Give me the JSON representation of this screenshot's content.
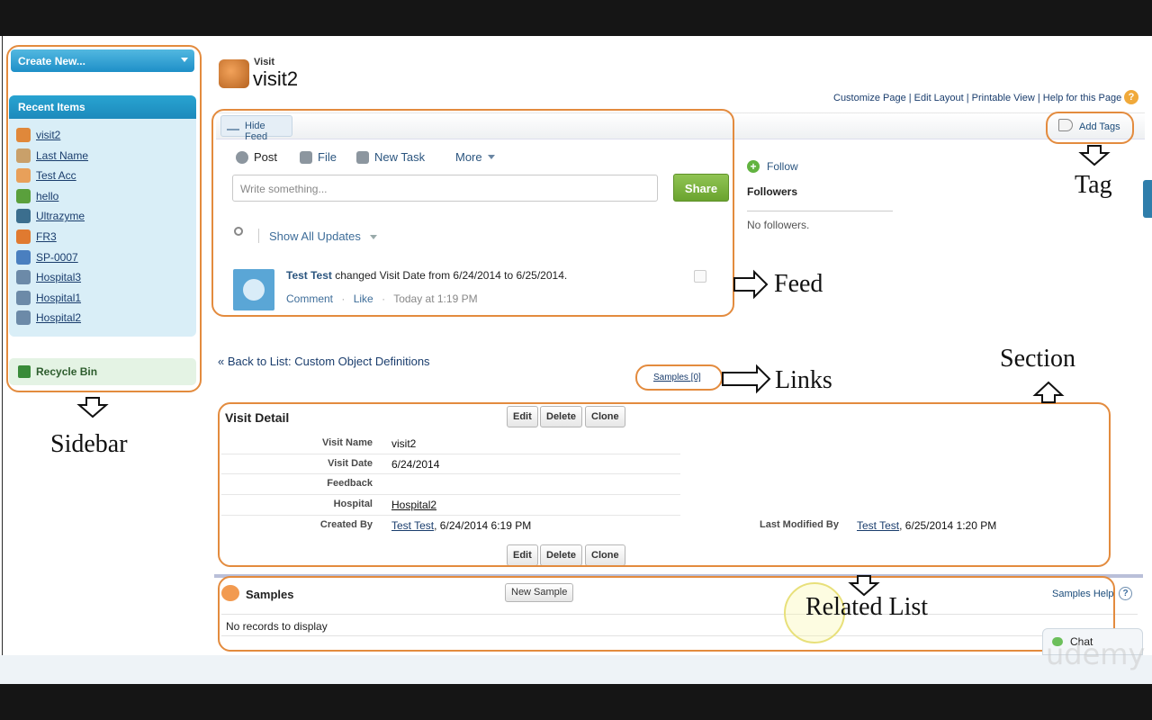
{
  "sidebar": {
    "create_new": "Create New...",
    "recent_title": "Recent Items",
    "items": [
      {
        "label": "visit2",
        "color": "#e0883a"
      },
      {
        "label": "Last Name",
        "color": "#c9a06a"
      },
      {
        "label": "Test Acc",
        "color": "#e8a05a"
      },
      {
        "label": "hello",
        "color": "#5aa03c"
      },
      {
        "label": "Ultrazyme",
        "color": "#3b6e8e"
      },
      {
        "label": "FR3",
        "color": "#e07a30"
      },
      {
        "label": "SP-0007",
        "color": "#4a7fbf"
      },
      {
        "label": "Hospital3",
        "color": "#6c8aa8"
      },
      {
        "label": "Hospital1",
        "color": "#6c8aa8"
      },
      {
        "label": "Hospital2",
        "color": "#6c8aa8"
      }
    ],
    "recycle_bin": "Recycle Bin"
  },
  "header": {
    "object_type": "Visit",
    "record_name": "visit2",
    "page_links": "Customize Page | Edit Layout | Printable View | Help for this Page",
    "help_icon": "?"
  },
  "feed": {
    "hide_feed": "Hide Feed",
    "add_tags": "Add Tags",
    "tabs": {
      "post": "Post",
      "file": "File",
      "new_task": "New Task",
      "more": "More"
    },
    "input_placeholder": "Write something...",
    "share": "Share",
    "show_all": "Show All Updates",
    "item": {
      "user": "Test Test",
      "text": "changed Visit Date from 6/24/2014 to 6/25/2014.",
      "comment": "Comment",
      "like": "Like",
      "time": "Today at 1:19 PM",
      "dot": "·"
    },
    "follow": "Follow",
    "plus": "+",
    "followers_title": "Followers",
    "no_followers": "No followers."
  },
  "nav": {
    "back_to_list": "« Back to List: Custom Object Definitions",
    "samples_link": "Samples [0]"
  },
  "detail": {
    "title": "Visit Detail",
    "buttons": {
      "edit": "Edit",
      "delete": "Delete",
      "clone": "Clone"
    },
    "fields": {
      "visit_name_label": "Visit Name",
      "visit_name": "visit2",
      "visit_date_label": "Visit Date",
      "visit_date": "6/24/2014",
      "feedback_label": "Feedback",
      "feedback": "",
      "hospital_label": "Hospital",
      "hospital": "Hospital2",
      "created_by_label": "Created By",
      "created_by_user": "Test Test",
      "created_by_date": ", 6/24/2014 6:19 PM",
      "modified_by_label": "Last Modified By",
      "modified_by_user": "Test Test",
      "modified_by_date": ", 6/25/2014 1:20 PM"
    }
  },
  "related": {
    "title": "Samples",
    "new_button": "New Sample",
    "help": "Samples Help",
    "help_icon": "?",
    "empty": "No records to display"
  },
  "chat": {
    "label": "Chat"
  },
  "annotations": {
    "sidebar": "Sidebar",
    "feed": "Feed",
    "links": "Links",
    "section": "Section",
    "tag": "Tag",
    "related_list": "Related List"
  },
  "watermark": "udemy"
}
